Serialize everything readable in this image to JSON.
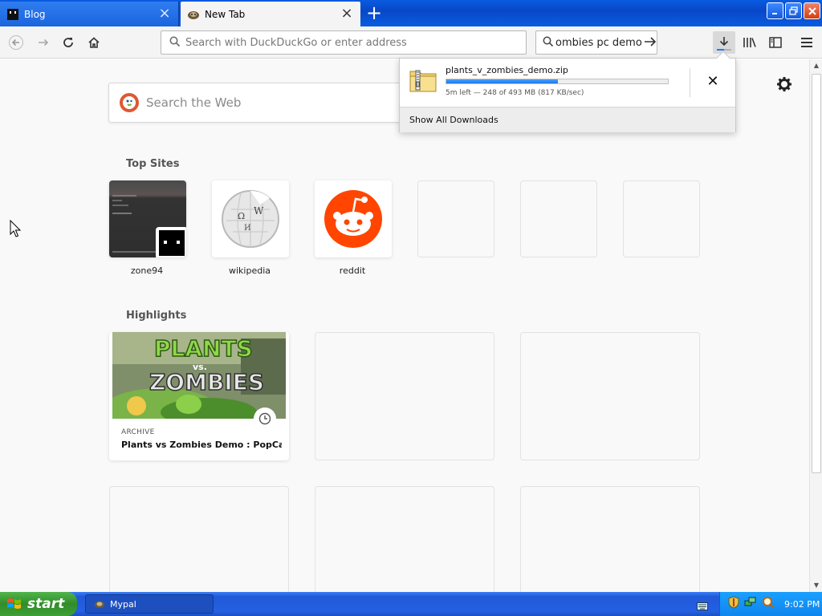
{
  "tabs": [
    {
      "label": "Blog",
      "active": false
    },
    {
      "label": "New Tab",
      "active": true
    }
  ],
  "toolbar": {
    "url_placeholder": "Search with DuckDuckGo or enter address",
    "search_text": "ombies pc demo",
    "download_progress": 0.5
  },
  "newtab": {
    "search_placeholder": "Search the Web",
    "topsites_title": "Top Sites",
    "topsites": [
      {
        "label": "zone94"
      },
      {
        "label": "wikipedia"
      },
      {
        "label": "reddit"
      }
    ],
    "highlights_title": "Highlights",
    "highlight": {
      "context": "ARCHIVE",
      "title": "Plants vs Zombies Demo : PopCa...",
      "image_text_1": "PLANTS",
      "image_text_2": "vs.",
      "image_text_3": "ZOMBIES"
    }
  },
  "downloads": {
    "filename": "plants_v_zombies_demo.zip",
    "status": "5m left — 248 of 493 MB (817 KB/sec)",
    "progress": 0.503,
    "show_all": "Show All Downloads"
  },
  "taskbar": {
    "start_label": "start",
    "task_label": "Mypal",
    "clock": "9:02 PM"
  },
  "colors": {
    "accent": "#0a84ff",
    "reddit": "#ff4500",
    "ddg": "#de5833",
    "xp_blue": "#2459d8",
    "xp_green": "#3ea036"
  },
  "icons": [
    "back-icon",
    "forward-icon",
    "reload-icon",
    "home-icon",
    "search-icon",
    "download-icon",
    "library-icon",
    "sidebar-icon",
    "menu-icon",
    "gear-icon",
    "clock-icon",
    "zip-file-icon"
  ]
}
